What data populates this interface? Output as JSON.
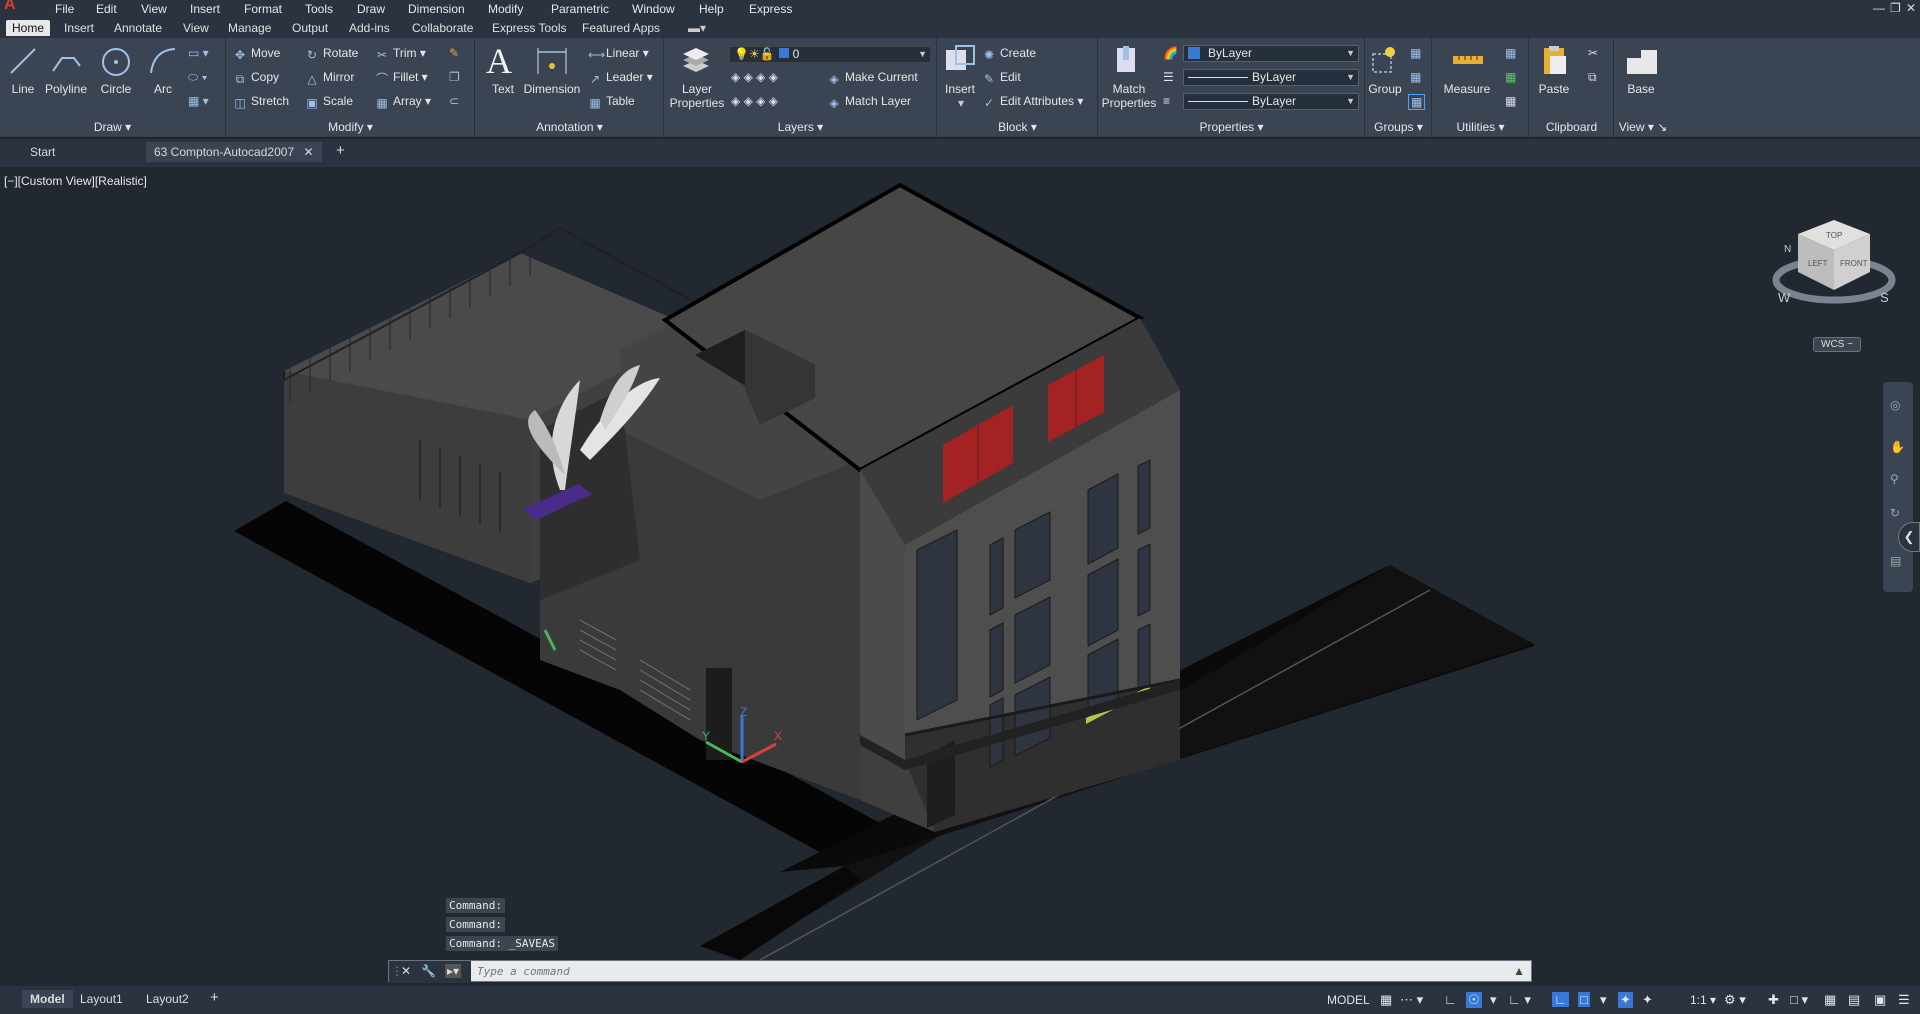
{
  "menubar": {
    "items": [
      "File",
      "Edit",
      "View",
      "Insert",
      "Format",
      "Tools",
      "Draw",
      "Dimension",
      "Modify",
      "Parametric",
      "Window",
      "Help",
      "Express"
    ]
  },
  "ribbon_tabs": [
    "Home",
    "Insert",
    "Annotate",
    "View",
    "Manage",
    "Output",
    "Add-ins",
    "Collaborate",
    "Express Tools",
    "Featured Apps"
  ],
  "draw": {
    "title": "Draw",
    "line": "Line",
    "polyline": "Polyline",
    "circle": "Circle",
    "arc": "Arc"
  },
  "modify": {
    "title": "Modify",
    "move": "Move",
    "rotate": "Rotate",
    "trim": "Trim",
    "copy": "Copy",
    "mirror": "Mirror",
    "fillet": "Fillet",
    "stretch": "Stretch",
    "scale": "Scale",
    "array": "Array"
  },
  "annotation": {
    "title": "Annotation",
    "text": "Text",
    "dimension": "Dimension",
    "linear": "Linear",
    "leader": "Leader",
    "table": "Table"
  },
  "layers": {
    "title": "Layers",
    "layer_properties": "Layer Properties",
    "current_layer": "0",
    "make_current": "Make Current",
    "match_layer": "Match Layer"
  },
  "block": {
    "title": "Block",
    "insert": "Insert",
    "create": "Create",
    "edit": "Edit",
    "edit_attributes": "Edit Attributes"
  },
  "properties": {
    "title": "Properties",
    "match_properties": "Match Properties",
    "color": "ByLayer",
    "linetype": "ByLayer",
    "lineweight": "ByLayer"
  },
  "groups": {
    "title": "Groups",
    "group": "Group"
  },
  "utilities": {
    "title": "Utilities",
    "measure": "Measure"
  },
  "clipboard": {
    "title": "Clipboard",
    "paste": "Paste"
  },
  "view": {
    "title": "View",
    "base": "Base"
  },
  "doc_tabs": {
    "start": "Start",
    "active": "63 Compton-Autocad2007"
  },
  "viewport": {
    "label": "[−][Custom View][Realistic]",
    "wcs": "WCS −",
    "cube_top": "TOP",
    "cube_left": "LEFT",
    "cube_front": "FRONT",
    "compass_w": "W",
    "compass_s": "S",
    "compass_n": "N"
  },
  "command": {
    "history": [
      "Command:",
      "Command:",
      "Command: _SAVEAS"
    ],
    "placeholder": "Type a command"
  },
  "layout_tabs": [
    "Model",
    "Layout1",
    "Layout2"
  ],
  "status": {
    "model": "MODEL",
    "scale": "1:1"
  },
  "colors": {
    "accent": "#e03c31",
    "window_red": "#a32222"
  }
}
